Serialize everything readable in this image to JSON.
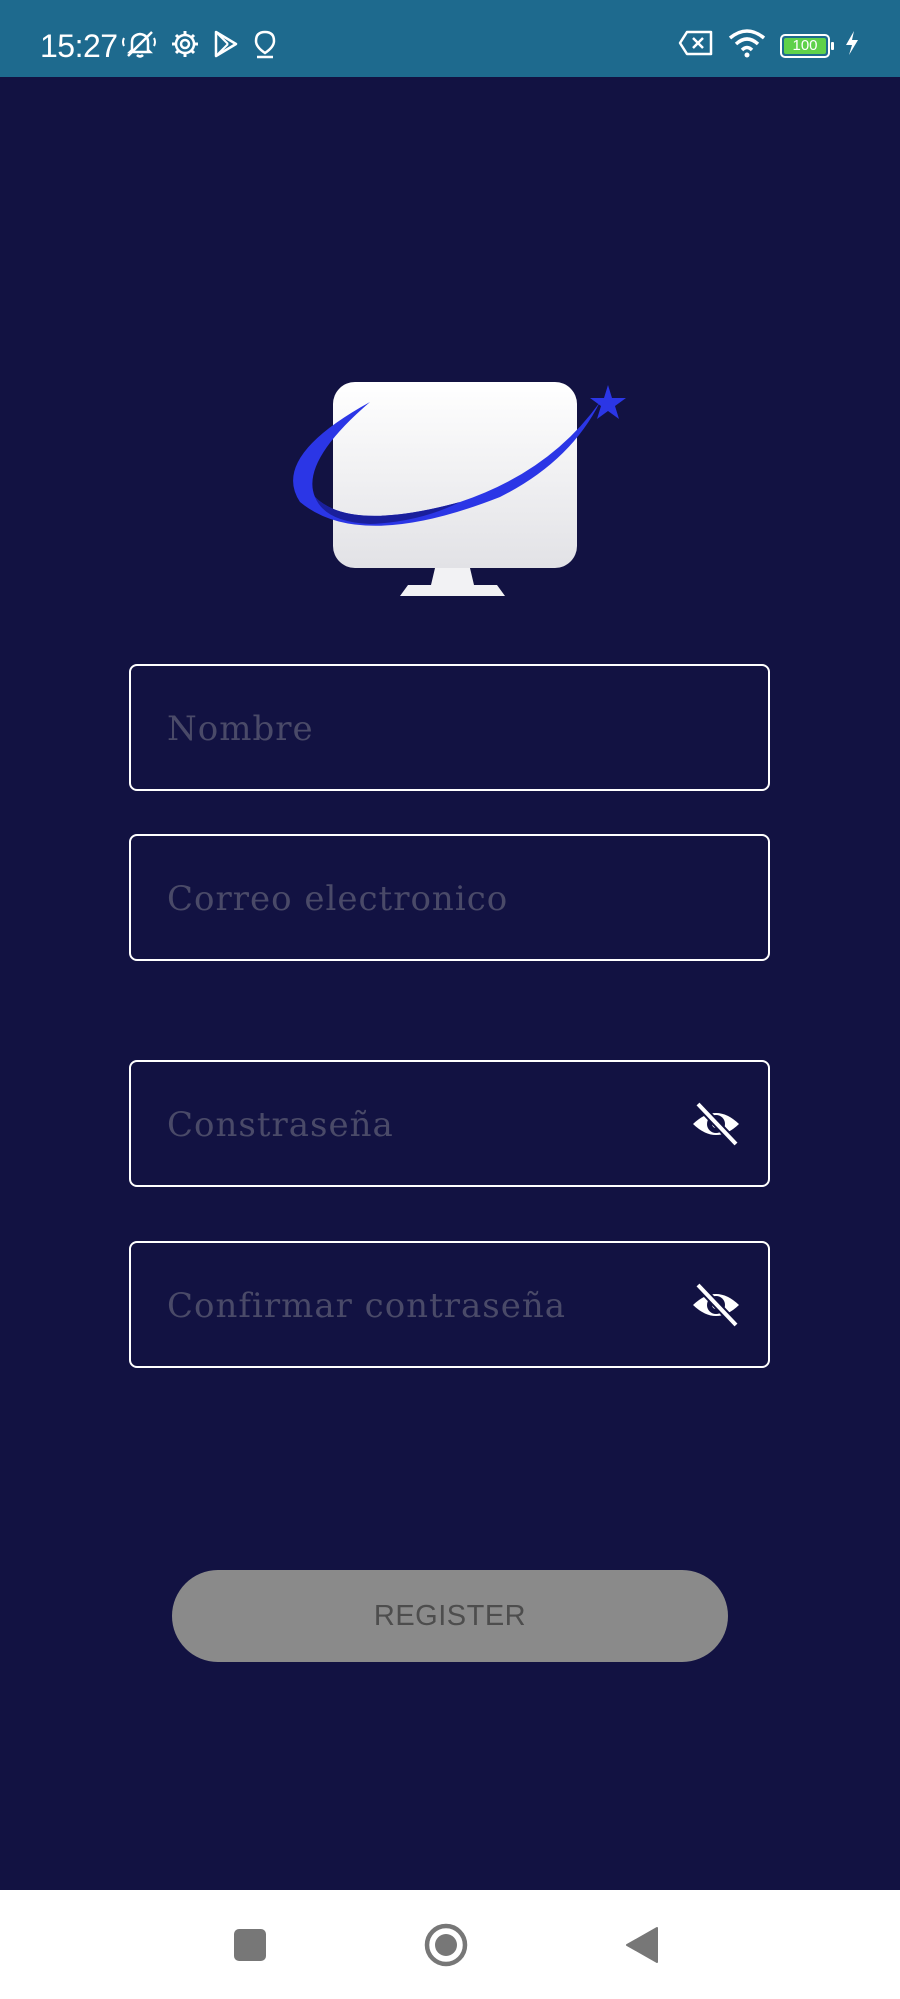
{
  "status_bar": {
    "time": "15:27",
    "battery_level": "100",
    "icons_left": [
      "notifications-off-icon",
      "settings-gear-icon",
      "play-store-icon",
      "location-icon"
    ],
    "icons_right": [
      "no-sim-icon",
      "wifi-icon",
      "battery-icon",
      "charging-bolt-icon"
    ]
  },
  "app": {
    "logo": "tv-monitor-swoosh-star-logo",
    "colors": {
      "background": "#121242",
      "status_bar": "#1e6a8e",
      "accent": "#2b36e6",
      "button_disabled": "#8a8a8a"
    }
  },
  "form": {
    "name": {
      "placeholder": "Nombre",
      "value": ""
    },
    "email": {
      "placeholder": "Correo electronico",
      "value": ""
    },
    "password": {
      "placeholder": "Constraseña",
      "value": "",
      "toggle_icon": "eye-off-icon"
    },
    "confirm_password": {
      "placeholder": "Confirmar contraseña",
      "value": "",
      "toggle_icon": "eye-off-icon"
    },
    "register_label": "REGISTER"
  },
  "nav_bar": {
    "buttons": [
      "recent-apps-icon",
      "home-icon",
      "back-icon"
    ]
  }
}
